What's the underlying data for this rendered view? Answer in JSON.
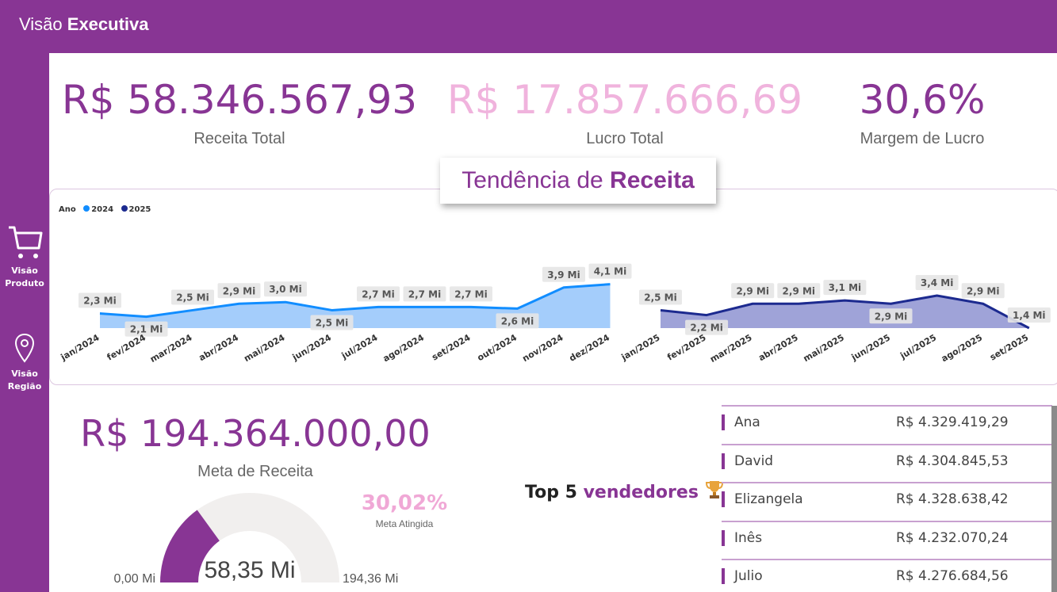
{
  "header": {
    "title_prefix": "Visão",
    "title_bold": "Executiva"
  },
  "nav": [
    {
      "line1": "Visão",
      "line2": "Produto",
      "icon": "shopping-cart-icon"
    },
    {
      "line1": "Visão",
      "line2": "Região",
      "icon": "map-pin-icon"
    }
  ],
  "kpis": {
    "receita": {
      "value": "R$ 58.346.567,93",
      "label": "Receita Total",
      "color": "#883594"
    },
    "lucro": {
      "value": "R$ 17.857.666,69",
      "label": "Lucro Total",
      "color": "#f0b3dd"
    },
    "margem": {
      "value": "30,6%",
      "label": "Margem de Lucro",
      "color": "#883594"
    }
  },
  "trend": {
    "title_prefix": "Tendência de",
    "title_bold": "Receita"
  },
  "chart_data": {
    "type": "area",
    "legend": {
      "title": "Ano",
      "placement": "top-left"
    },
    "categories": [
      "jan/2024",
      "fev/2024",
      "mar/2024",
      "abr/2024",
      "mai/2024",
      "jun/2024",
      "jul/2024",
      "ago/2024",
      "set/2024",
      "out/2024",
      "nov/2024",
      "dez/2024",
      "jan/2025",
      "fev/2025",
      "mar/2025",
      "abr/2025",
      "mai/2025",
      "jun/2025",
      "jul/2025",
      "ago/2025",
      "set/2025"
    ],
    "series": [
      {
        "name": "2024",
        "color": "#118dff",
        "fill": "#a4cdfb",
        "start": 0,
        "values": [
          2.3,
          2.1,
          2.5,
          2.9,
          3.0,
          2.5,
          2.7,
          2.7,
          2.7,
          2.6,
          3.9,
          4.1
        ],
        "labels": [
          "2,3 Mi",
          "2,1 Mi",
          "2,5 Mi",
          "2,9 Mi",
          "3,0 Mi",
          "2,5 Mi",
          "2,7 Mi",
          "2,7 Mi",
          "2,7 Mi",
          "2,6 Mi",
          "3,9 Mi",
          "4,1 Mi"
        ]
      },
      {
        "name": "2025",
        "color": "#1c2a8f",
        "fill": "#9fa3d8",
        "start": 12,
        "values": [
          2.5,
          2.2,
          2.9,
          2.9,
          3.1,
          2.9,
          3.4,
          2.9,
          1.4
        ],
        "labels": [
          "2,5 Mi",
          "2,2 Mi",
          "2,9 Mi",
          "2,9 Mi",
          "3,1 Mi",
          "2,9 Mi",
          "3,4 Mi",
          "2,9 Mi",
          "1,4 Mi"
        ]
      }
    ]
  },
  "meta": {
    "value": "R$ 194.364.000,00",
    "label": "Meta de Receita"
  },
  "gauge": {
    "current": 58.35,
    "max": 194.36,
    "current_label": "58,35 Mi",
    "min_label": "0,00 Mi",
    "max_label": "194,36 Mi",
    "fill_color": "#883594",
    "track_color": "#f1efee"
  },
  "meta_pct": {
    "value": "30,02%",
    "label": "Meta Atingida"
  },
  "top5": {
    "prefix": "Top 5",
    "highlight": "vendedores",
    "icon": "trophy-icon",
    "rows": [
      {
        "name": "Ana",
        "amount": "R$ 4.329.419,29"
      },
      {
        "name": "David",
        "amount": "R$ 4.304.845,53"
      },
      {
        "name": "Elizangela",
        "amount": "R$ 4.328.638,42"
      },
      {
        "name": "Inês",
        "amount": "R$ 4.232.070,24"
      },
      {
        "name": "Julio",
        "amount": "R$ 4.276.684,56"
      }
    ]
  }
}
